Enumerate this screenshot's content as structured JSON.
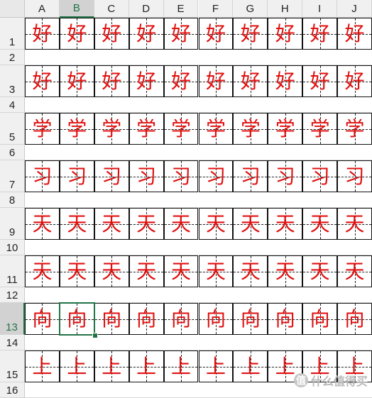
{
  "columns": [
    "A",
    "B",
    "C",
    "D",
    "E",
    "F",
    "G",
    "H",
    "I",
    "J"
  ],
  "active_column": "B",
  "active_row": "13",
  "rows": [
    {
      "header": "1",
      "type": "char",
      "char": "好"
    },
    {
      "header": "2",
      "type": "gap"
    },
    {
      "header": "3",
      "type": "char",
      "char": "好"
    },
    {
      "header": "4",
      "type": "gap"
    },
    {
      "header": "5",
      "type": "char",
      "char": "学"
    },
    {
      "header": "6",
      "type": "gap"
    },
    {
      "header": "7",
      "type": "char",
      "char": "习"
    },
    {
      "header": "8",
      "type": "gap"
    },
    {
      "header": "9",
      "type": "char",
      "char": "天"
    },
    {
      "header": "10",
      "type": "gap"
    },
    {
      "header": "11",
      "type": "char",
      "char": "天"
    },
    {
      "header": "12",
      "type": "gap"
    },
    {
      "header": "13",
      "type": "char",
      "char": "向"
    },
    {
      "header": "14",
      "type": "gap"
    },
    {
      "header": "15",
      "type": "char",
      "char": "上"
    },
    {
      "header": "16",
      "type": "gap"
    }
  ],
  "colors": {
    "char": "#e01010",
    "selection": "#217346"
  },
  "watermark": {
    "badge": "值",
    "text": "什么值得买"
  }
}
